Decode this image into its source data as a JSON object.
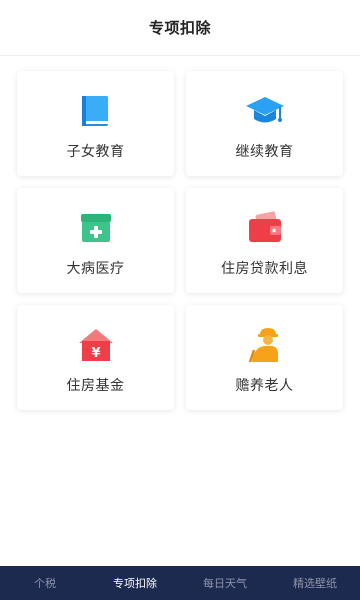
{
  "header": {
    "title": "专项扣除"
  },
  "cards": [
    {
      "label": "子女教育",
      "icon": "book-icon",
      "color": "#2aa1f2"
    },
    {
      "label": "继续教育",
      "icon": "graduation-cap-icon",
      "color": "#2aa1f2"
    },
    {
      "label": "大病医疗",
      "icon": "medical-kit-icon",
      "color": "#3cc48b"
    },
    {
      "label": "住房贷款利息",
      "icon": "wallet-icon",
      "color": "#f05155"
    },
    {
      "label": "住房基金",
      "icon": "house-yen-icon",
      "color": "#f05155"
    },
    {
      "label": "赡养老人",
      "icon": "elderly-person-icon",
      "color": "#f6a21a"
    }
  ],
  "tabbar": {
    "tabs": [
      {
        "label": "个税",
        "active": false
      },
      {
        "label": "专项扣除",
        "active": true
      },
      {
        "label": "每日天气",
        "active": false
      },
      {
        "label": "精选壁纸",
        "active": false
      }
    ]
  }
}
